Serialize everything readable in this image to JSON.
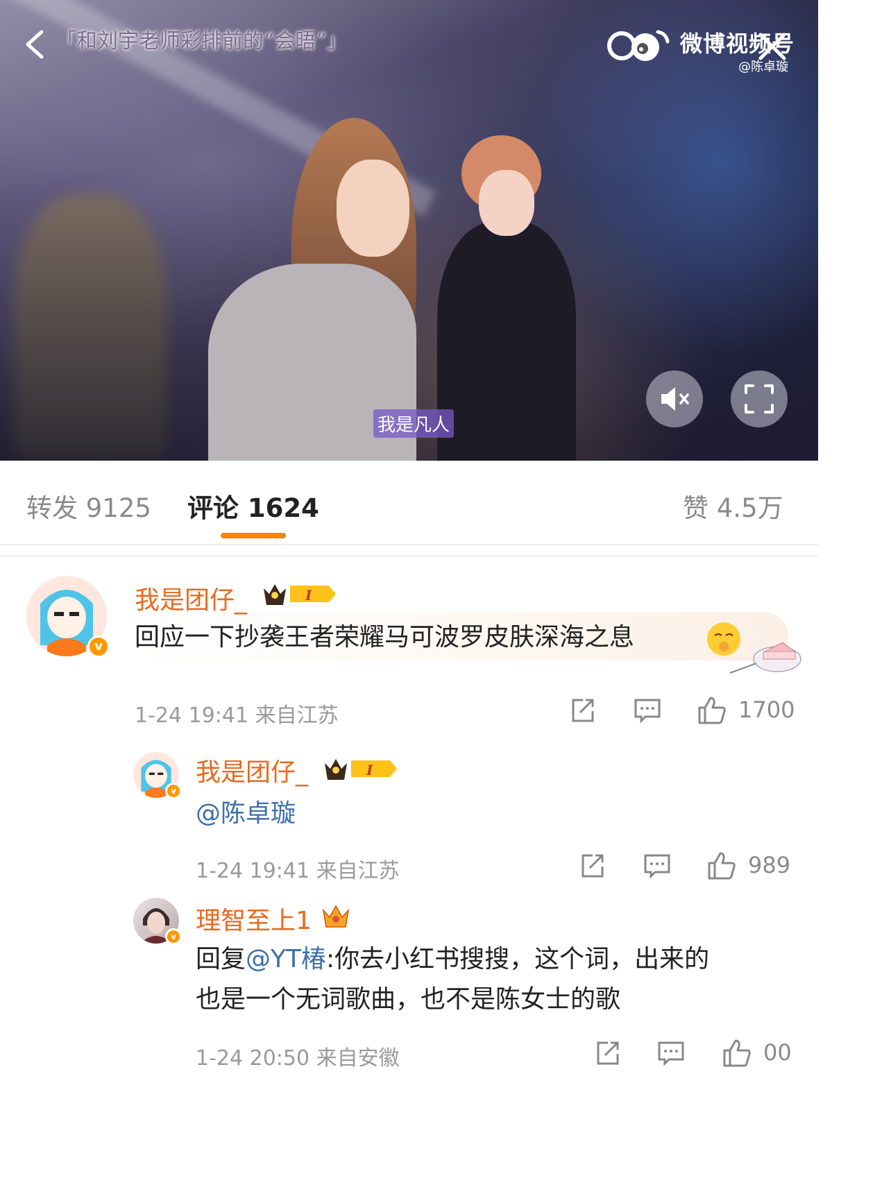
{
  "video": {
    "title": "「和刘宇老师彩排前的“会晤”」",
    "brand": "微博视频号",
    "handle": "@陈卓璇",
    "subtitle": "我是凡人"
  },
  "tabs": {
    "repost": "转发 9125",
    "comment": "评论 1624",
    "like": "赞 4.5万"
  },
  "comments": [
    {
      "username": "我是团仔_",
      "text": "回应一下抄袭王者荣耀马可波罗皮肤深海之息",
      "time": "1-24 19:41",
      "location": "来自江苏",
      "likes": "1700"
    },
    {
      "username": "我是团仔_",
      "mention": "@陈卓璇",
      "time": "1-24 19:41",
      "location": "来自江苏",
      "likes": "989"
    },
    {
      "username": "理智至上1",
      "reply_prefix": "回复",
      "reply_to": "@YT椿",
      "line1_rest": ":你去小红书搜搜，这个词，出来的",
      "line2": "也是一个无词歌曲，也不是陈女士的歌",
      "time": "1-24 20:50",
      "location": "来自安徽",
      "likes": "00"
    }
  ],
  "colors": {
    "accent": "#ff8200",
    "username": "#e86a1f",
    "mention": "#3f6fa8",
    "meta": "#9a9a9a"
  }
}
